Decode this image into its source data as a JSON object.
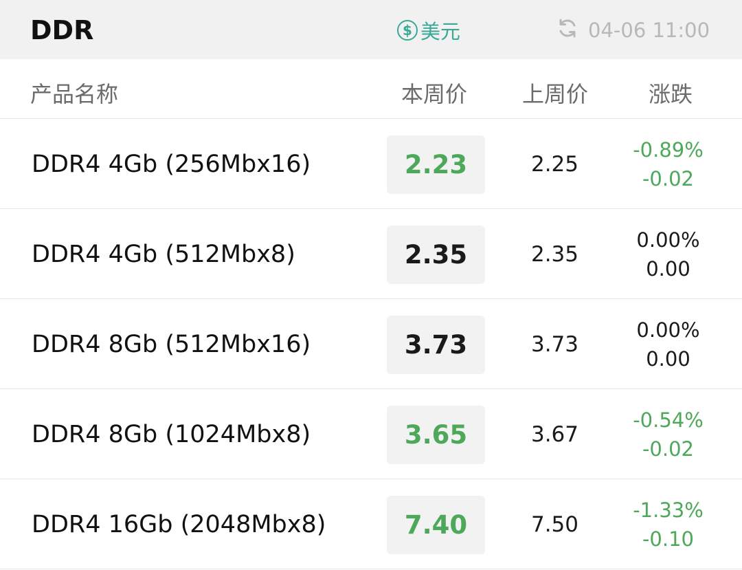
{
  "header": {
    "title": "DDR",
    "currency_symbol": "$",
    "currency_label": "美元",
    "refresh_icon": "refresh-icon",
    "timestamp": "04-06 11:00"
  },
  "columns": {
    "name": "产品名称",
    "current": "本周价",
    "last": "上周价",
    "change": "涨跌"
  },
  "colors": {
    "accent": "#3aa897",
    "down": "#4ea85a",
    "flat": "#1a1a1a"
  },
  "rows": [
    {
      "name": "DDR4 4Gb (256Mbx16)",
      "current": "2.23",
      "last": "2.25",
      "pct": "-0.89%",
      "diff": "-0.02",
      "trend": "down"
    },
    {
      "name": "DDR4 4Gb (512Mbx8)",
      "current": "2.35",
      "last": "2.35",
      "pct": "0.00%",
      "diff": "0.00",
      "trend": "flat"
    },
    {
      "name": "DDR4 8Gb (512Mbx16)",
      "current": "3.73",
      "last": "3.73",
      "pct": "0.00%",
      "diff": "0.00",
      "trend": "flat"
    },
    {
      "name": "DDR4 8Gb (1024Mbx8)",
      "current": "3.65",
      "last": "3.67",
      "pct": "-0.54%",
      "diff": "-0.02",
      "trend": "down"
    },
    {
      "name": "DDR4 16Gb (2048Mbx8)",
      "current": "7.40",
      "last": "7.50",
      "pct": "-1.33%",
      "diff": "-0.10",
      "trend": "down"
    }
  ]
}
